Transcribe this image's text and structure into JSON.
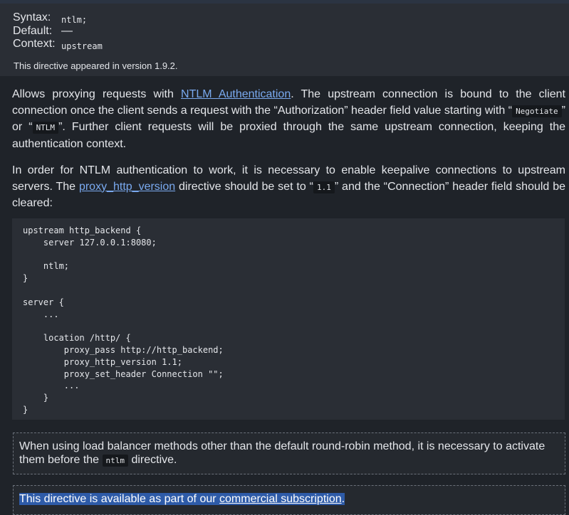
{
  "directive": {
    "syntax_label": "Syntax:",
    "syntax_value": "ntlm;",
    "default_label": "Default:",
    "default_value": "—",
    "context_label": "Context:",
    "context_value": "upstream",
    "appeared": "This directive appeared in version 1.9.2."
  },
  "para1": {
    "t1": "Allows proxying requests with ",
    "link1": "NTLM Authentication",
    "t2": ". The upstream connection is bound to the client connection once the client sends a request with the “Authorization” header field value starting with “",
    "code1": "Negotiate",
    "t3": "” or “",
    "code2": "NTLM",
    "t4": "”. Further client requests will be proxied through the same upstream connection, keeping the authentication context."
  },
  "para2": {
    "t1": "In order for NTLM authentication to work, it is necessary to enable keepalive connections to upstream servers. The ",
    "link1": "proxy_http_version",
    "t2": " directive should be set to “",
    "code1": "1.1",
    "t3": "” and the “Connection” header field should be cleared:"
  },
  "code_example": "upstream http_backend {\n    server 127.0.0.1:8080;\n\n    ntlm;\n}\n\nserver {\n    ...\n\n    location /http/ {\n        proxy_pass http://http_backend;\n        proxy_http_version 1.1;\n        proxy_set_header Connection \"\";\n        ...\n    }\n}",
  "note1": {
    "t1": "When using load balancer methods other than the default round-robin method, it is necessary to activate them before the ",
    "code1": "ntlm",
    "t2": " directive."
  },
  "note2": {
    "t1": "This directive is available as part of our ",
    "link1": "commercial subscription",
    "t2": "."
  },
  "colors": {
    "background": "#1f2329",
    "panel": "#2a2e35",
    "link": "#7aaaf0",
    "selection": "#2e5ba8"
  }
}
